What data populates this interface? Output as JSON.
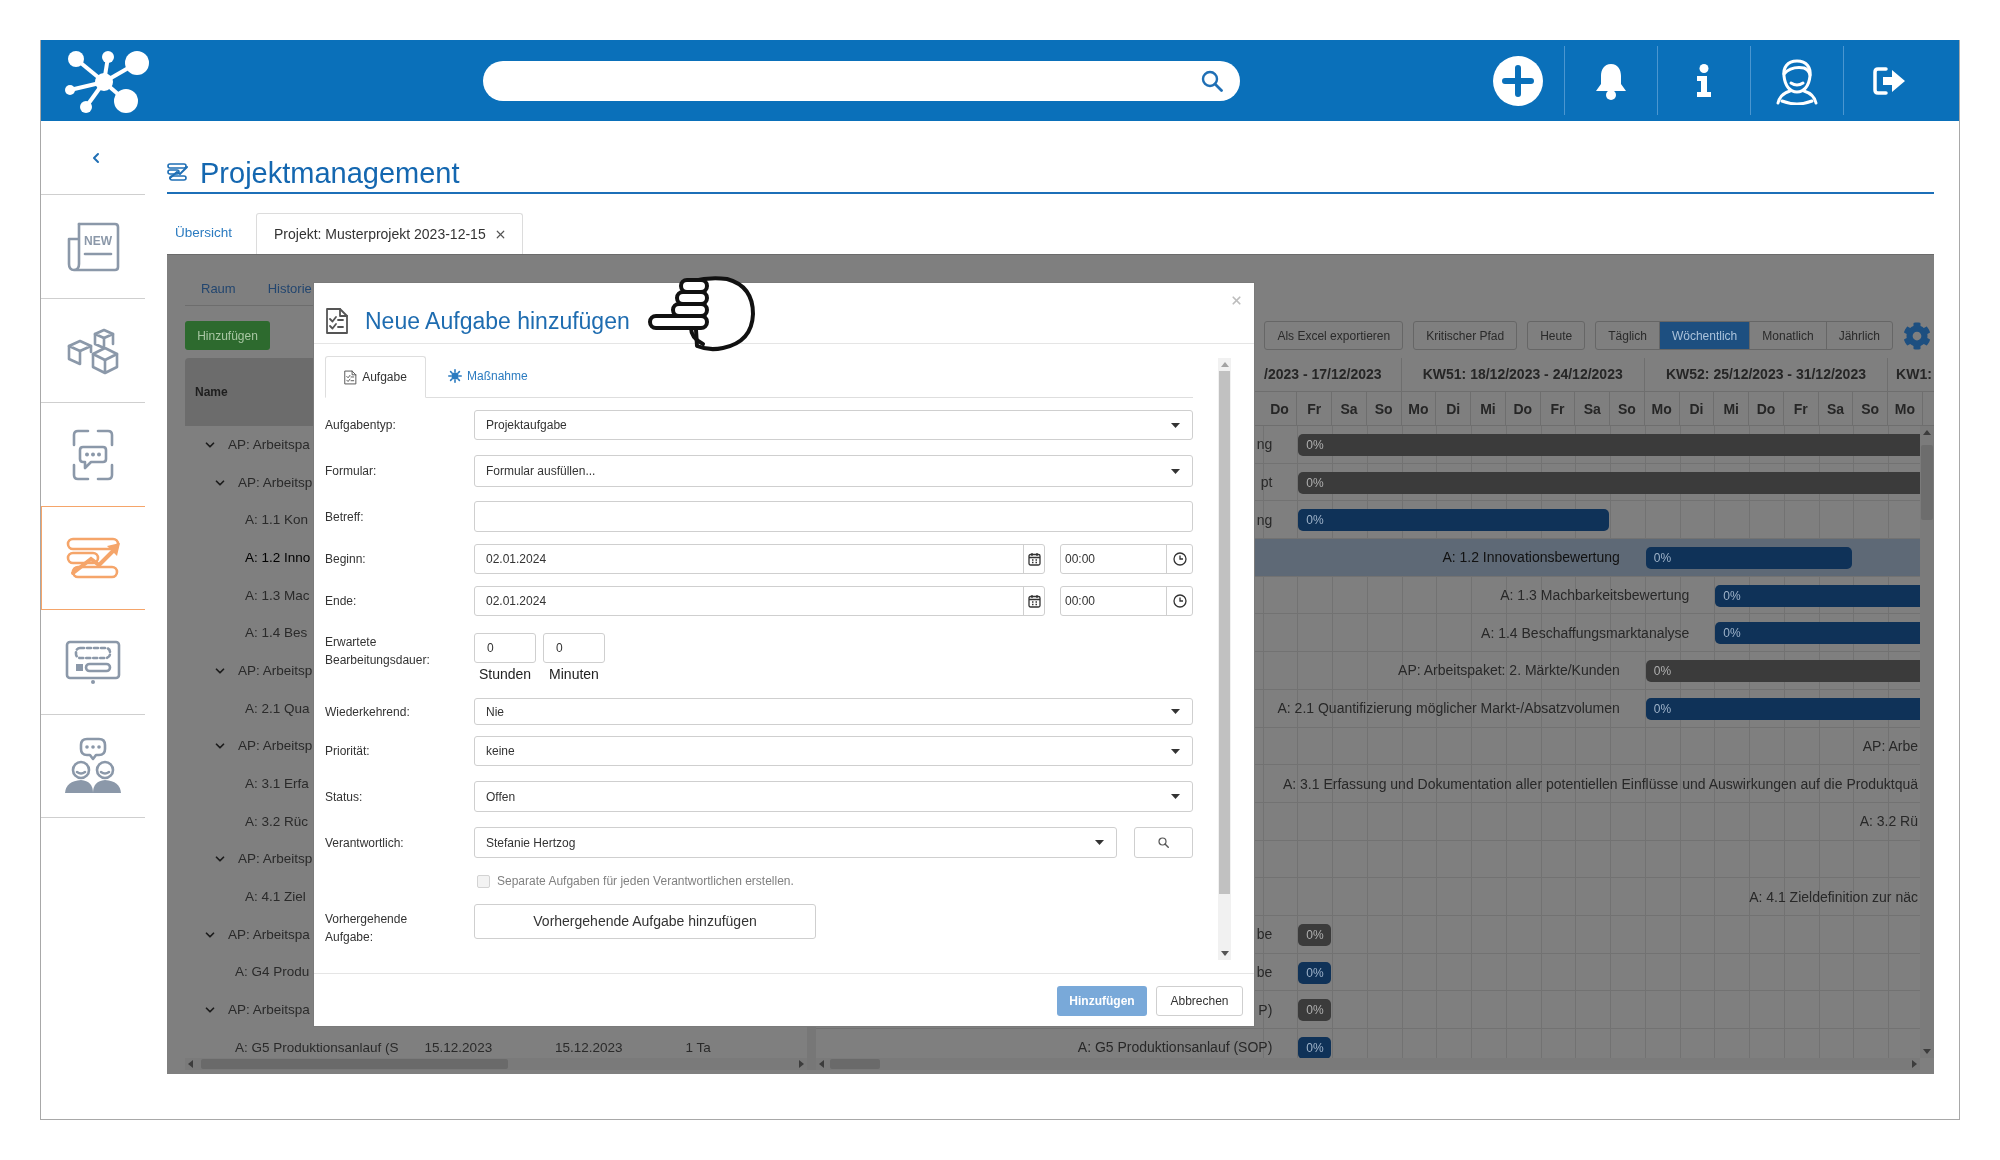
{
  "header": {
    "actions": [
      {
        "kind": "add"
      },
      {
        "kind": "notifications"
      },
      {
        "kind": "info"
      },
      {
        "kind": "profile"
      },
      {
        "kind": "logout"
      }
    ]
  },
  "sidebar": {
    "items": [
      {
        "kind": "news",
        "label": "NEW",
        "selected": false
      },
      {
        "kind": "cubes",
        "selected": false
      },
      {
        "kind": "chat-frame",
        "selected": false
      },
      {
        "kind": "chart",
        "selected": true
      },
      {
        "kind": "form",
        "selected": false
      },
      {
        "kind": "people",
        "selected": false
      }
    ]
  },
  "page": {
    "title": "Projektmanagement",
    "tabs": [
      {
        "label": "Übersicht",
        "selected": false,
        "closable": false
      },
      {
        "label": "Projekt: Musterprojekt 2023-12-15",
        "selected": true,
        "closable": true
      }
    ]
  },
  "project": {
    "tabs": [
      {
        "label": "Raum",
        "selected": false
      },
      {
        "label": "Historie",
        "selected": false
      }
    ],
    "add_button": "Hinzufügen"
  },
  "table": {
    "columns": [
      "Name"
    ],
    "rows": [
      {
        "label": "AP: Arbeitspa",
        "expanded": true,
        "selected": false,
        "children": [
          {
            "label": "AP: Arbeitsp",
            "expanded": true,
            "selected": false,
            "children": [
              {
                "label": "A: 1.1 Kon",
                "selected": false
              },
              {
                "label": "A: 1.2 Inno",
                "selected": true
              },
              {
                "label": "A: 1.3 Mac",
                "selected": false
              },
              {
                "label": "A: 1.4 Bes",
                "selected": false
              }
            ]
          },
          {
            "label": "AP: Arbeitsp",
            "expanded": true,
            "selected": false,
            "children": [
              {
                "label": "A: 2.1 Qua",
                "selected": false
              }
            ]
          },
          {
            "label": "AP: Arbeitsp",
            "expanded": true,
            "selected": false,
            "children": [
              {
                "label": "A: 3.1 Erfa",
                "selected": false
              },
              {
                "label": "A: 3.2 Rüc",
                "selected": false
              }
            ]
          },
          {
            "label": "AP: Arbeitsp",
            "expanded": true,
            "selected": false,
            "children": [
              {
                "label": "A: 4.1 Ziel",
                "selected": false
              }
            ]
          }
        ]
      },
      {
        "label": "AP: Arbeitspa",
        "expanded": true,
        "selected": false,
        "children": [
          {
            "label": "A: G4 Produ",
            "selected": false
          }
        ]
      },
      {
        "label": "AP: Arbeitspa",
        "expanded": true,
        "selected": false,
        "children": [
          {
            "label": "A: G5 Produktionsanlauf (S",
            "selected": false,
            "cells": [
              "15.12.2023",
              "15.12.2023",
              "1 Ta"
            ]
          }
        ]
      }
    ]
  },
  "gantt": {
    "toolbar": [
      {
        "label": "Als Excel exportieren"
      },
      {
        "label": "Kritischer Pfad"
      },
      {
        "label": "Heute"
      }
    ],
    "scales": [
      {
        "label": "Täglich",
        "selected": false
      },
      {
        "label": "Wöchentlich",
        "selected": true
      },
      {
        "label": "Monatlich",
        "selected": false
      },
      {
        "label": "Jährlich",
        "selected": false
      }
    ],
    "weeks": [
      {
        "label": "/2023 - 17/12/2023",
        "days": [
          "Do",
          "Fr",
          "Sa",
          "So"
        ]
      },
      {
        "label": "KW51: 18/12/2023 - 24/12/2023",
        "days": [
          "Mo",
          "Di",
          "Mi",
          "Do",
          "Fr",
          "Sa",
          "So"
        ]
      },
      {
        "label": "KW52: 25/12/2023 - 31/12/2023",
        "days": [
          "Mo",
          "Di",
          "Mi",
          "Do",
          "Fr",
          "Sa",
          "So"
        ]
      },
      {
        "label": "KW1:",
        "days": [
          "Mo"
        ]
      }
    ],
    "rows": [
      {
        "label": "ng",
        "selected": false,
        "bar": {
          "kind": "package",
          "label": "0%"
        }
      },
      {
        "label": "pt",
        "selected": false,
        "bar": {
          "kind": "package",
          "label": "0%"
        }
      },
      {
        "label": "ng",
        "selected": false,
        "bar": {
          "kind": "task",
          "label": "0%"
        }
      },
      {
        "label": "A: 1.2 Innovationsbewertung",
        "selected": true,
        "bar": {
          "kind": "task",
          "label": "0%"
        }
      },
      {
        "label": "A: 1.3 Machbarkeitsbewertung",
        "selected": false,
        "bar": {
          "kind": "task",
          "label": "0%"
        }
      },
      {
        "label": "A: 1.4 Beschaffungsmarktanalyse",
        "selected": false,
        "bar": {
          "kind": "task",
          "label": "0%"
        }
      },
      {
        "label": "AP: Arbeitspaket: 2. Märkte/Kunden",
        "selected": false,
        "bar": {
          "kind": "package",
          "label": "0%"
        }
      },
      {
        "label": "A: 2.1 Quantifizierung möglicher Markt-/Absatzvolumen",
        "selected": false,
        "bar": {
          "kind": "task",
          "label": "0%"
        }
      },
      {
        "label": "AP: Arbe",
        "selected": false
      },
      {
        "label": "A: 3.1 Erfassung und Dokumentation aller potentiellen Einflüsse und Auswirkungen auf die Produktquä",
        "selected": false
      },
      {
        "label": "A: 3.2 Rü",
        "selected": false
      },
      {
        "selected": false
      },
      {
        "label": "A: 4.1 Zieldefinition zur näc",
        "selected": false
      },
      {
        "label": "be",
        "selected": false,
        "bar": {
          "kind": "package",
          "label": "0%"
        }
      },
      {
        "label": "be",
        "selected": false,
        "bar": {
          "kind": "task",
          "label": "0%"
        }
      },
      {
        "label": "P)",
        "selected": false,
        "bar": {
          "kind": "package",
          "label": "0%"
        }
      },
      {
        "label": "A: G5 Produktionsanlauf (SOP)",
        "selected": false,
        "bar": {
          "kind": "task",
          "label": "0%"
        }
      }
    ]
  },
  "dialog": {
    "title": "Neue Aufgabe hinzufügen",
    "tabs": [
      {
        "kind": "task",
        "label": "Aufgabe",
        "selected": true
      },
      {
        "kind": "measure",
        "label": "Maßnahme",
        "selected": false
      }
    ],
    "fields": [
      {
        "kind": "select",
        "label": "Aufgabentyp:",
        "value": "Projektaufgabe"
      },
      {
        "kind": "select",
        "label": "Formular:",
        "value": "Formular ausfüllen..."
      },
      {
        "kind": "text",
        "label": "Betreff:"
      },
      {
        "kind": "datetime",
        "label": "Beginn:",
        "date": "02.01.2024",
        "time": "00:00"
      },
      {
        "kind": "datetime",
        "label": "Ende:",
        "date": "02.01.2024",
        "time": "00:00"
      },
      {
        "kind": "duration",
        "label": "Erwartete Bearbeitungsdauer:",
        "parts": [
          {
            "value": "0",
            "unit": "Stunden"
          },
          {
            "value": "0",
            "unit": "Minuten"
          }
        ]
      },
      {
        "kind": "select",
        "label": "Wiederkehrend:",
        "value": "Nie"
      },
      {
        "kind": "select",
        "label": "Priorität:",
        "value": "keine"
      },
      {
        "kind": "select",
        "label": "Status:",
        "value": "Offen"
      },
      {
        "kind": "lookup",
        "label": "Verantwortlich:",
        "value": "Stefanie Hertzog"
      },
      {
        "kind": "checkbox",
        "label": "Separate Aufgaben für jeden Verantwortlichen erstellen.",
        "checked": false,
        "disabled": true
      },
      {
        "kind": "button",
        "label": "Vorhergehende Aufgabe:",
        "button": "Vorhergehende Aufgabe hinzufügen"
      }
    ],
    "buttons": [
      {
        "kind": "primary",
        "label": "Hinzufügen"
      },
      {
        "kind": "secondary",
        "label": "Abbrechen"
      }
    ]
  }
}
